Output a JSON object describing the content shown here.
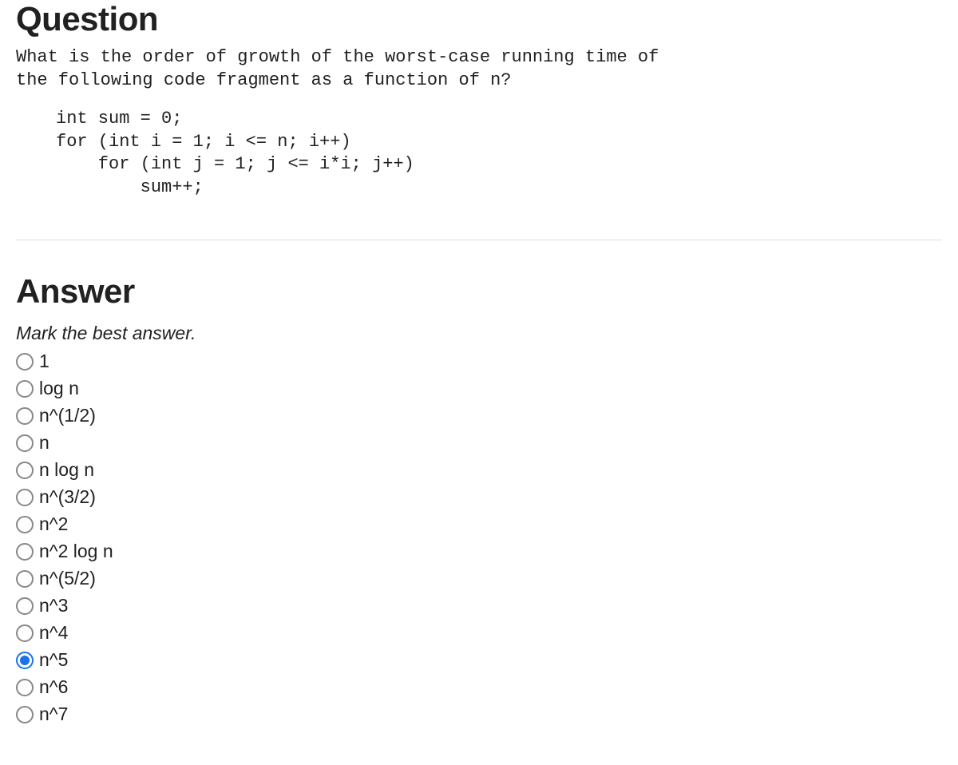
{
  "question": {
    "heading": "Question",
    "text": "What is the order of growth of the worst-case running time of\nthe following code fragment as a function of n?",
    "code": "int sum = 0;\nfor (int i = 1; i <= n; i++)\n    for (int j = 1; j <= i*i; j++)\n        sum++;"
  },
  "answer": {
    "heading": "Answer",
    "instruction": "Mark the best answer.",
    "options": [
      {
        "label": "1",
        "selected": false
      },
      {
        "label": "log n",
        "selected": false
      },
      {
        "label": "n^(1/2)",
        "selected": false
      },
      {
        "label": "n",
        "selected": false
      },
      {
        "label": "n log n",
        "selected": false
      },
      {
        "label": "n^(3/2)",
        "selected": false
      },
      {
        "label": "n^2",
        "selected": false
      },
      {
        "label": "n^2 log n",
        "selected": false
      },
      {
        "label": "n^(5/2)",
        "selected": false
      },
      {
        "label": "n^3",
        "selected": false
      },
      {
        "label": "n^4",
        "selected": false
      },
      {
        "label": "n^5",
        "selected": true
      },
      {
        "label": "n^6",
        "selected": false
      },
      {
        "label": "n^7",
        "selected": false
      }
    ]
  }
}
